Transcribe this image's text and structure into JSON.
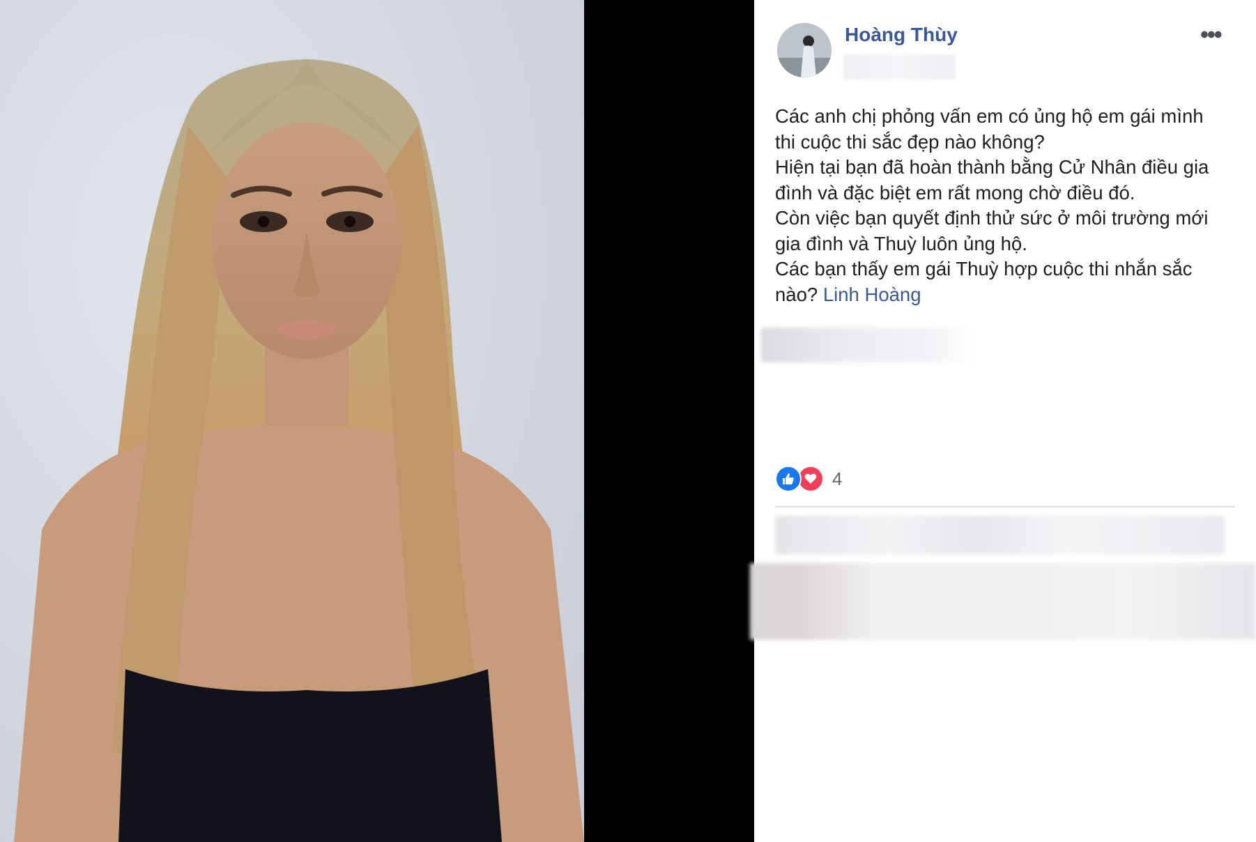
{
  "post": {
    "author": "Hoàng Thùy",
    "more_icon": "•••",
    "body_lines": [
      "Các anh chị phỏng vấn em có ủng hộ em gái mình",
      "thi cuộc thi sắc đẹp nào không?",
      "Hiện tại bạn đã hoàn thành bằng Cử Nhân điều gia",
      "đình và đặc biệt em rất mong chờ điều đó.",
      "Còn việc bạn quyết định thử sức ở môi trường mới",
      "gia đình và Thuỳ luôn ủng hộ.",
      "Các bạn thấy em gái Thuỳ hợp cuộc thi nhắn sắc"
    ],
    "last_line_prefix": "nào? ",
    "mention": "Linh Hoàng",
    "reaction_count": "4",
    "reaction_icons": [
      "like-icon",
      "love-icon"
    ]
  },
  "colors": {
    "link": "#385898",
    "text": "#1c1e21",
    "like": "#1877f2",
    "love": "#f33e58",
    "panel_bg": "#ffffff",
    "outer_bg": "#000000"
  }
}
